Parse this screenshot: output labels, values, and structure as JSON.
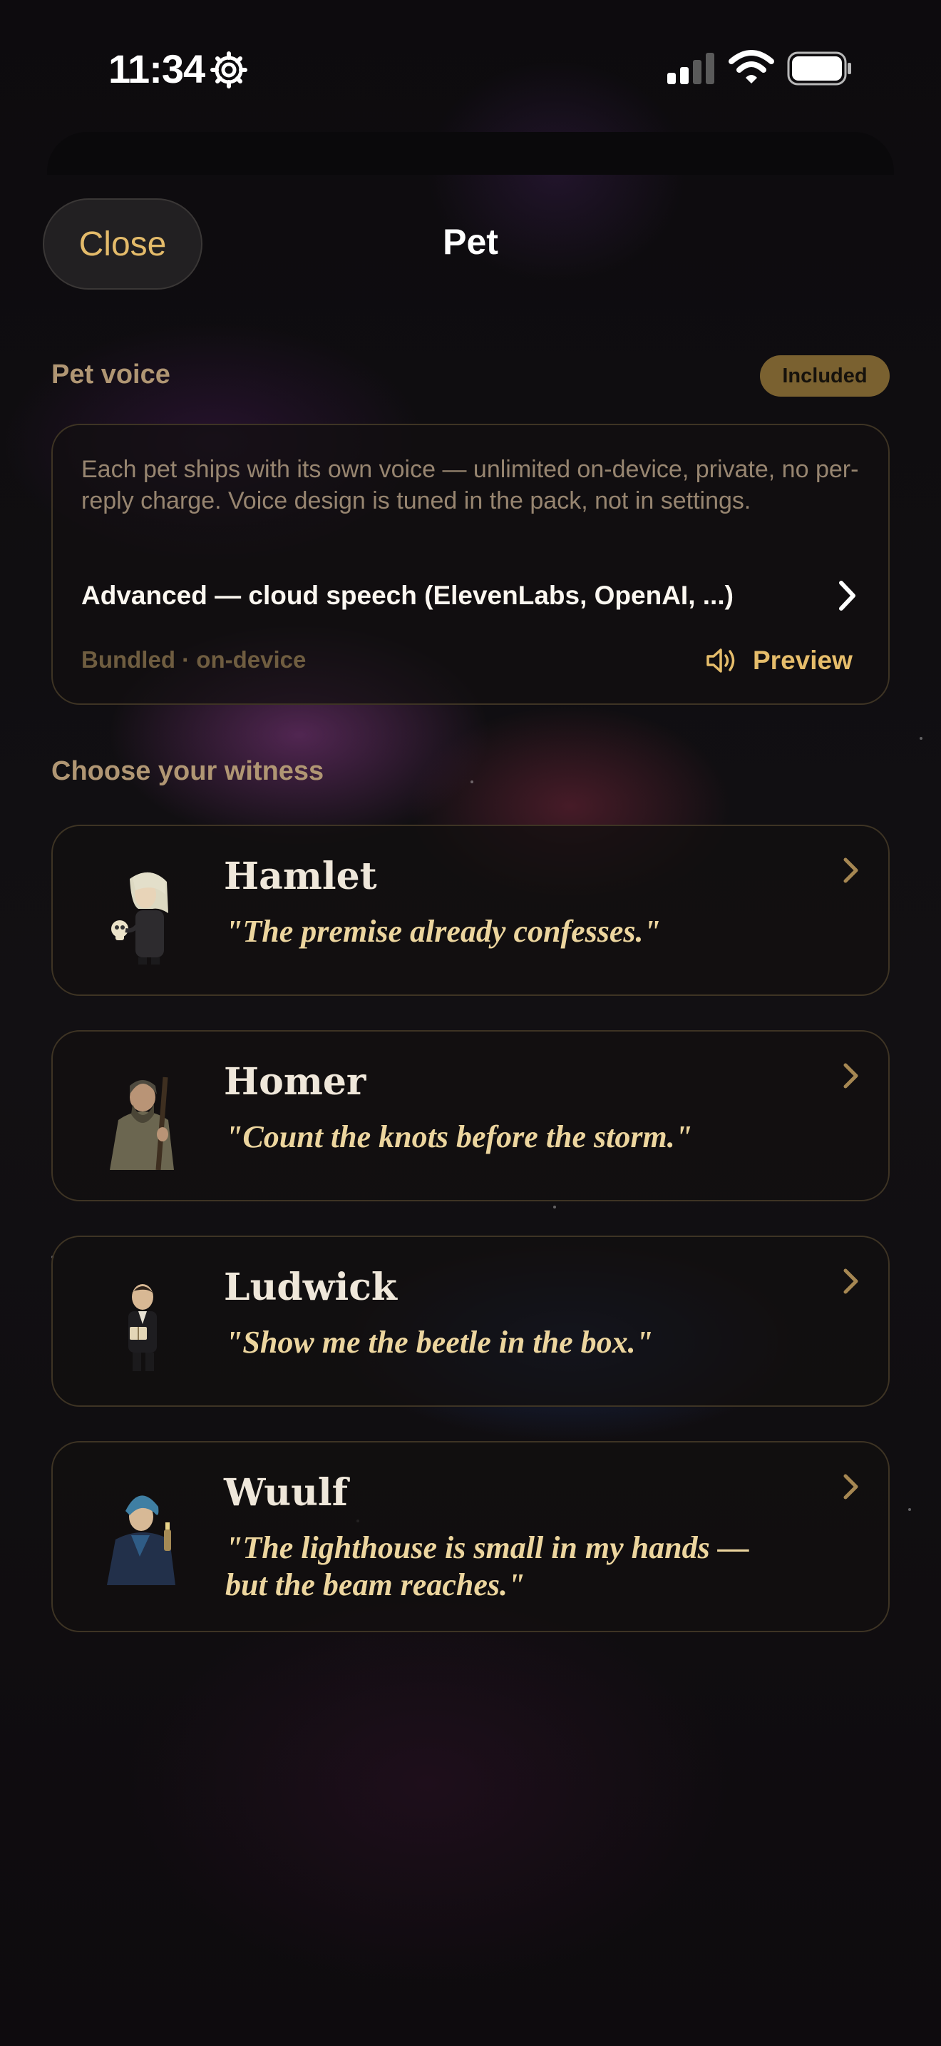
{
  "status_bar": {
    "time": "11:34"
  },
  "header": {
    "close_label": "Close",
    "title": "Pet"
  },
  "pet_voice": {
    "section_label": "Pet voice",
    "badge": "Included",
    "description": "Each pet ships with its own voice — unlimited on-device, private, no per-reply charge. Voice design is tuned in the pack, not in settings.",
    "advanced_link": "Advanced — cloud speech (ElevenLabs, OpenAI, ...)",
    "bundled_label": "Bundled · on-device",
    "preview_label": "Preview"
  },
  "witness": {
    "section_label": "Choose your witness",
    "characters": [
      {
        "name": "Hamlet",
        "quote": "\"The premise already confesses.\""
      },
      {
        "name": "Homer",
        "quote": "\"Count the knots before the storm.\""
      },
      {
        "name": "Ludwick",
        "quote": "\"Show me the beetle in the box.\""
      },
      {
        "name": "Wuulf",
        "quote": "\"The lighthouse is small in my hands — but the beam reaches.\""
      }
    ]
  },
  "colors": {
    "accent": "#e6bd6b",
    "badge_bg": "#7a6130",
    "quote": "#ecd59e",
    "card_border": "#3e3424"
  }
}
